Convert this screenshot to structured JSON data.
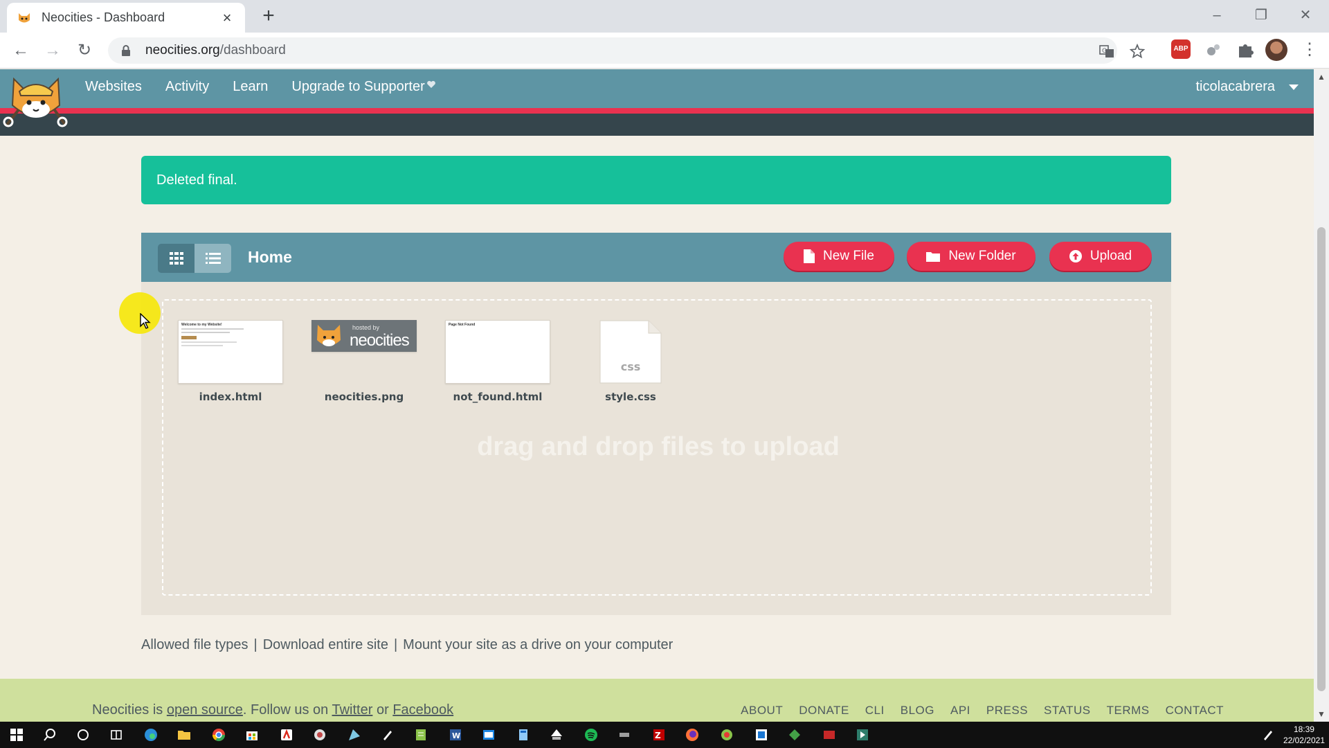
{
  "browser": {
    "tab_title": "Neocities - Dashboard",
    "url_host": "neocities.org",
    "url_path": "/dashboard"
  },
  "site": {
    "nav": [
      "Websites",
      "Activity",
      "Learn",
      "Upgrade to Supporter"
    ],
    "username": "ticolacabrera"
  },
  "flash": {
    "message": "Deleted final."
  },
  "files": {
    "title": "Home",
    "buttons": {
      "new_file": "New File",
      "new_folder": "New Folder",
      "upload": "Upload"
    },
    "items": [
      {
        "name": "index.html"
      },
      {
        "name": "neocities.png"
      },
      {
        "name": "not_found.html"
      },
      {
        "name": "style.css",
        "icon_label": "css"
      }
    ],
    "dropzone_text": "drag and drop files to upload",
    "thumb_text": {
      "index_heading": "Welcome to my Website!",
      "png_small": "hosted by",
      "png_brand": "neocities",
      "notfound_heading": "Page Not Found"
    }
  },
  "links": {
    "allowed": "Allowed file types",
    "download": "Download entire site",
    "mount": "Mount your site as a drive on your computer",
    "separator": "|"
  },
  "footer": {
    "prefix": "Neocities is",
    "open_source": "open source",
    "follow": ". Follow us on",
    "twitter": "Twitter",
    "or": "or",
    "facebook": "Facebook",
    "links": [
      "ABOUT",
      "DONATE",
      "CLI",
      "BLOG",
      "API",
      "PRESS",
      "STATUS",
      "TERMS",
      "CONTACT"
    ]
  },
  "taskbar": {
    "time": "18:39",
    "date": "22/02/2021"
  },
  "colors": {
    "header_teal": "#5e95a4",
    "accent_red": "#e93250",
    "flash_green": "#16c09a",
    "footer_green": "#cfe09d",
    "page_bg": "#f4efe6"
  },
  "icons": [
    "neocities-cat-icon",
    "lock-icon",
    "translate-icon",
    "star-icon",
    "abp-icon",
    "extension-icon",
    "puzzle-icon",
    "grid-view-icon",
    "list-view-icon",
    "file-icon",
    "folder-icon",
    "upload-icon",
    "heart-icon",
    "windows-start-icon"
  ]
}
